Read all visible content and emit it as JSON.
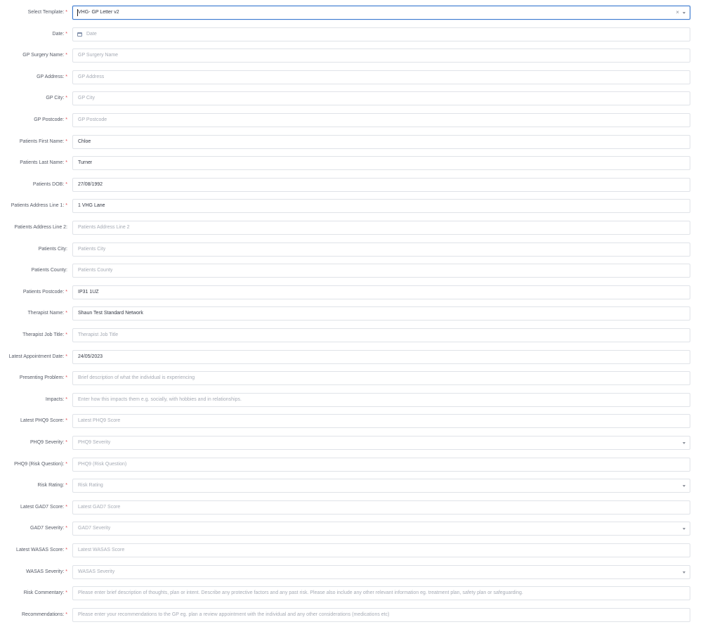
{
  "form": {
    "fields": [
      {
        "name": "select-template",
        "label": "Select Template:",
        "required": true,
        "type": "select",
        "value": "VHG- GP Letter v2",
        "placeholder": "",
        "clear": "×",
        "focused": true
      },
      {
        "name": "date",
        "label": "Date:",
        "required": true,
        "type": "date",
        "value": "",
        "placeholder": "Date",
        "icon": "calendar-icon"
      },
      {
        "name": "gp-surgery-name",
        "label": "GP Surgery Name:",
        "required": true,
        "type": "text",
        "value": "",
        "placeholder": "GP Surgery Name"
      },
      {
        "name": "gp-address",
        "label": "GP Address:",
        "required": true,
        "type": "text",
        "value": "",
        "placeholder": "GP Address"
      },
      {
        "name": "gp-city",
        "label": "GP City:",
        "required": true,
        "type": "text",
        "value": "",
        "placeholder": "GP City"
      },
      {
        "name": "gp-postcode",
        "label": "GP Postcode:",
        "required": true,
        "type": "text",
        "value": "",
        "placeholder": "GP Postcode"
      },
      {
        "name": "patients-first-name",
        "label": "Patients First Name:",
        "required": true,
        "type": "text",
        "value": "Chloe",
        "placeholder": ""
      },
      {
        "name": "patients-last-name",
        "label": "Patients Last Name:",
        "required": true,
        "type": "text",
        "value": "Turner",
        "placeholder": ""
      },
      {
        "name": "patients-dob",
        "label": "Patients DOB:",
        "required": true,
        "type": "text",
        "value": "27/08/1992",
        "placeholder": ""
      },
      {
        "name": "patients-address-line-1",
        "label": "Patients Address Line 1:",
        "required": true,
        "type": "text",
        "value": "1 VHG Lane",
        "placeholder": ""
      },
      {
        "name": "patients-address-line-2",
        "label": "Patients Address Line 2:",
        "required": false,
        "type": "text",
        "value": "",
        "placeholder": "Patients Address Line 2"
      },
      {
        "name": "patients-city",
        "label": "Patients City:",
        "required": false,
        "type": "text",
        "value": "",
        "placeholder": "Patients City"
      },
      {
        "name": "patients-county",
        "label": "Patients County:",
        "required": false,
        "type": "text",
        "value": "",
        "placeholder": "Patients County"
      },
      {
        "name": "patients-postcode",
        "label": "Patients Postcode:",
        "required": true,
        "type": "text",
        "value": "IP31 1UZ",
        "placeholder": ""
      },
      {
        "name": "therapist-name",
        "label": "Therapist Name:",
        "required": true,
        "type": "text",
        "value": "Shaun Test Standard Network",
        "placeholder": ""
      },
      {
        "name": "therapist-job-title",
        "label": "Therapist Job Title:",
        "required": true,
        "type": "text",
        "value": "",
        "placeholder": "Therapist Job Title"
      },
      {
        "name": "latest-appointment-date",
        "label": "Latest Appointment Date:",
        "required": true,
        "type": "text",
        "value": "24/05/2023",
        "placeholder": ""
      },
      {
        "name": "presenting-problem",
        "label": "Presenting Problem:",
        "required": true,
        "type": "text",
        "value": "",
        "placeholder": "Brief description of what the individual is experiencing"
      },
      {
        "name": "impacts",
        "label": "Impacts:",
        "required": true,
        "type": "text",
        "value": "",
        "placeholder": "Enter how this impacts them e.g. socially, with hobbies and in relationships."
      },
      {
        "name": "latest-phq9-score",
        "label": "Latest PHQ9 Score:",
        "required": true,
        "type": "text",
        "value": "",
        "placeholder": "Latest PHQ9 Score"
      },
      {
        "name": "phq9-severity",
        "label": "PHQ9 Severity:",
        "required": true,
        "type": "select",
        "value": "",
        "placeholder": "PHQ9 Severity"
      },
      {
        "name": "phq9-risk-question",
        "label": "PHQ9 (Risk Question):",
        "required": true,
        "type": "text",
        "value": "",
        "placeholder": "PHQ9 (Risk Question)"
      },
      {
        "name": "risk-rating",
        "label": "Risk Rating:",
        "required": true,
        "type": "select",
        "value": "",
        "placeholder": "Risk Rating"
      },
      {
        "name": "latest-gad7-score",
        "label": "Latest GAD7 Score:",
        "required": true,
        "type": "text",
        "value": "",
        "placeholder": "Latest GAD7 Score"
      },
      {
        "name": "gad7-severity",
        "label": "GAD7 Severity:",
        "required": true,
        "type": "select",
        "value": "",
        "placeholder": "GAD7 Severity"
      },
      {
        "name": "latest-wasas-score",
        "label": "Latest WASAS Score:",
        "required": true,
        "type": "text",
        "value": "",
        "placeholder": "Latest WASAS Score"
      },
      {
        "name": "wasas-severity",
        "label": "WASAS Severity:",
        "required": true,
        "type": "select",
        "value": "",
        "placeholder": "WASAS Severity"
      },
      {
        "name": "risk-commentary",
        "label": "Risk Commentary:",
        "required": true,
        "type": "text",
        "value": "",
        "placeholder": "Please enter brief description of thoughts, plan or intent. Describe any protective factors and any past risk. Please also include any other relevant information eg. treatment plan, safety plan or safeguarding."
      },
      {
        "name": "recommendations",
        "label": "Recommendations:",
        "required": true,
        "type": "text",
        "value": "",
        "placeholder": "Please enter your recommendations to the GP eg. plan a review appointment with the individual and any other considerations (medications etc)"
      }
    ],
    "required_marker": "*",
    "colors": {
      "required": "#e0464e",
      "focus_border": "#3d7bd0",
      "border": "#e0e3e8",
      "placeholder": "#a6abb5"
    }
  }
}
